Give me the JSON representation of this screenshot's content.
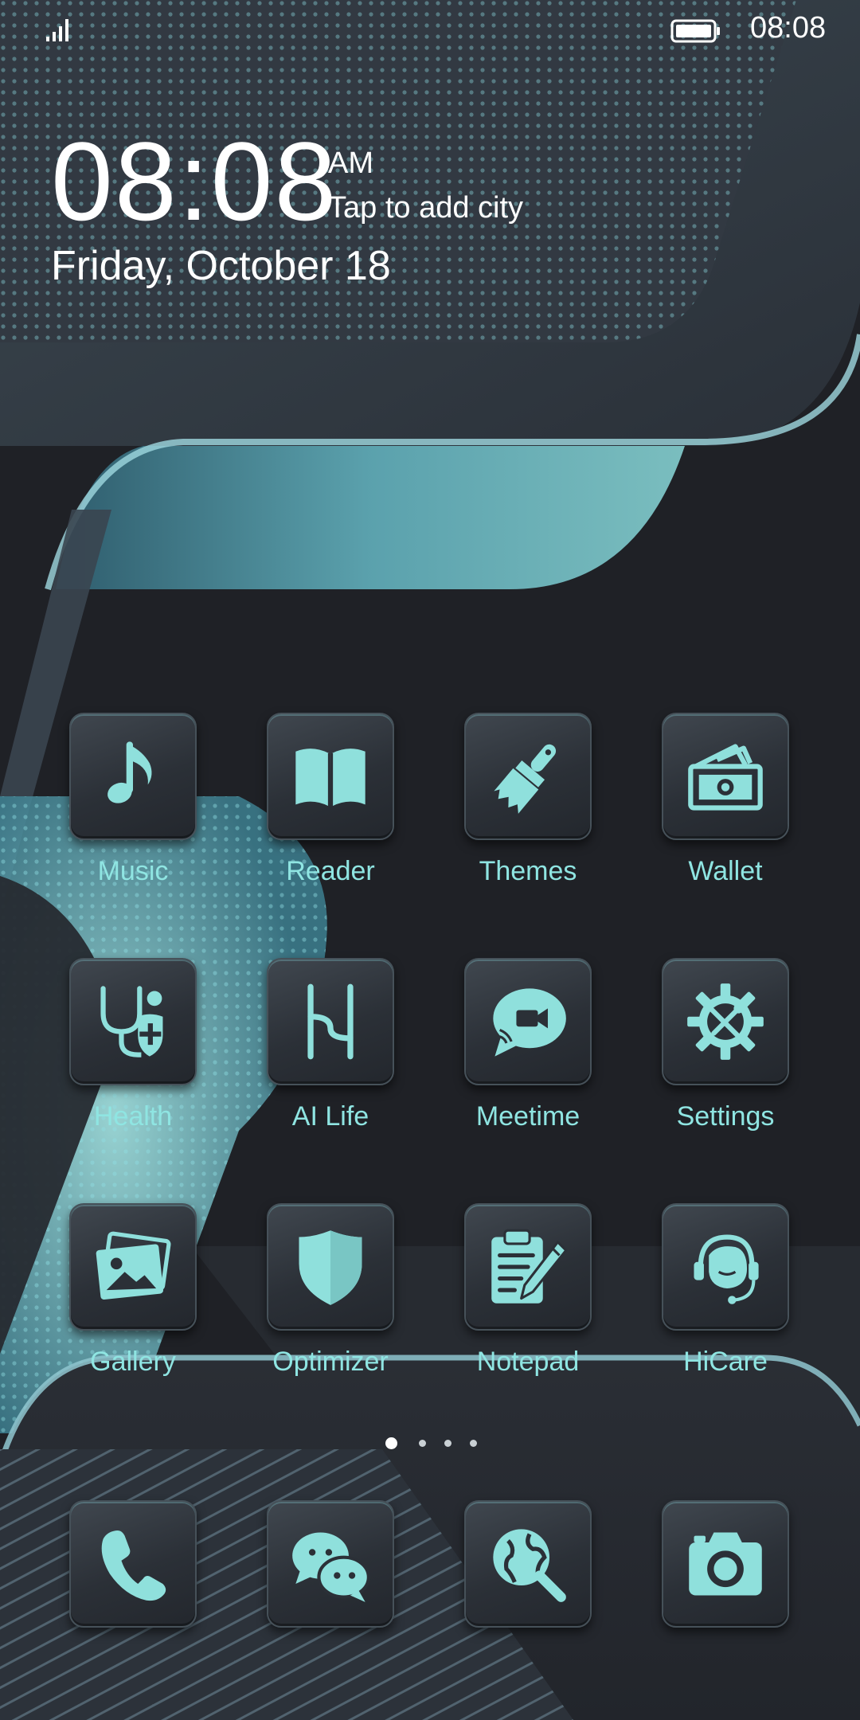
{
  "status_bar": {
    "time": "08:08"
  },
  "clock": {
    "time": "08:08",
    "ampm": "AM",
    "city_prompt": "Tap to add city",
    "date": "Friday, October 18"
  },
  "apps": [
    {
      "label": "Music",
      "icon": "music-note-icon"
    },
    {
      "label": "Reader",
      "icon": "book-icon"
    },
    {
      "label": "Themes",
      "icon": "paintbrush-icon"
    },
    {
      "label": "Wallet",
      "icon": "wallet-icon"
    },
    {
      "label": "Health",
      "icon": "stethoscope-icon"
    },
    {
      "label": "AI Life",
      "icon": "ai-life-icon"
    },
    {
      "label": "Meetime",
      "icon": "video-chat-icon"
    },
    {
      "label": "Settings",
      "icon": "gear-wrench-icon"
    },
    {
      "label": "Gallery",
      "icon": "photo-icon"
    },
    {
      "label": "Optimizer",
      "icon": "shield-icon"
    },
    {
      "label": "Notepad",
      "icon": "clipboard-pencil-icon"
    },
    {
      "label": "HiCare",
      "icon": "headset-icon"
    }
  ],
  "dock": [
    {
      "icon": "phone-icon"
    },
    {
      "icon": "chat-bubbles-icon"
    },
    {
      "icon": "globe-search-icon"
    },
    {
      "icon": "camera-icon"
    }
  ],
  "pages": {
    "count": 4,
    "active": 1
  },
  "colors": {
    "accent": "#8fe5e2",
    "background": "#1f2126"
  }
}
